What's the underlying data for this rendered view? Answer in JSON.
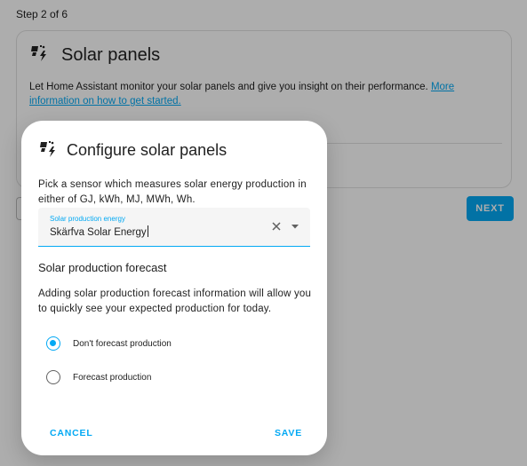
{
  "step": {
    "label": "Step 2 of 6"
  },
  "card": {
    "title": "Solar panels",
    "description": "Let Home Assistant monitor your solar panels and give you insight on their performance. ",
    "link_text": "More information on how to get started."
  },
  "wizard": {
    "next_label": "NEXT"
  },
  "dialog": {
    "title": "Configure solar panels",
    "description": "Pick a sensor which measures solar energy production in either of GJ, kWh, MJ, MWh, Wh.",
    "field": {
      "label": "Solar production energy",
      "value": "Skärfva Solar Energy"
    },
    "forecast": {
      "title": "Solar production forecast",
      "description": "Adding solar production forecast information will allow you to quickly see your expected production for today.",
      "options": [
        {
          "label": "Don't forecast production",
          "selected": true
        },
        {
          "label": "Forecast production",
          "selected": false
        }
      ]
    },
    "cancel_label": "CANCEL",
    "save_label": "SAVE"
  },
  "colors": {
    "accent": "#03a9f4",
    "text": "#212121",
    "scrim": "rgba(0,0,0,0.32)"
  },
  "icons": {
    "card_icon": "solar-power-icon",
    "dialog_icon": "solar-power-icon",
    "clear": "close-icon",
    "dropdown": "menu-down-icon"
  }
}
